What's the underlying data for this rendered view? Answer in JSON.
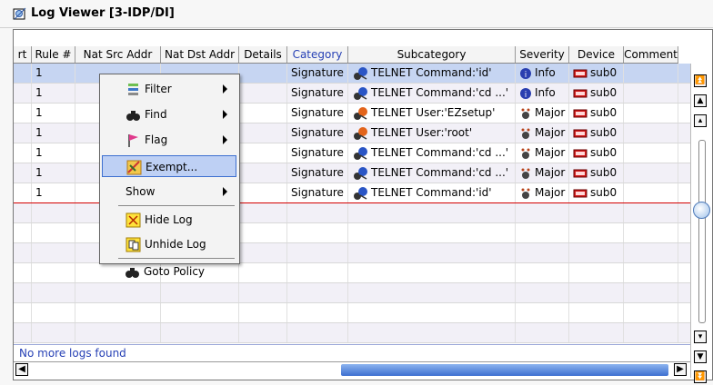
{
  "window": {
    "title": "Log Viewer [3-IDP/DI]"
  },
  "columns": [
    {
      "label": "rt",
      "w": 20
    },
    {
      "label": "Rule #",
      "w": 48
    },
    {
      "label": "Nat Src Addr",
      "w": 94
    },
    {
      "label": "Nat Dst Addr",
      "w": 86
    },
    {
      "label": "Details",
      "w": 53
    },
    {
      "label": "Category",
      "w": 67
    },
    {
      "label": "Subcategory",
      "w": 184
    },
    {
      "label": "Severity",
      "w": 59
    },
    {
      "label": "Device",
      "w": 60
    },
    {
      "label": "Comment",
      "w": 60
    }
  ],
  "rows": [
    {
      "rule": "1",
      "category": "Signature",
      "subcategory": "TELNET Command:'id'",
      "severity": "Info",
      "device": "sub0"
    },
    {
      "rule": "1",
      "category": "Signature",
      "subcategory": "TELNET Command:'cd ...'",
      "severity": "Info",
      "device": "sub0"
    },
    {
      "rule": "1",
      "category": "Signature",
      "subcategory": "TELNET User:'EZsetup'",
      "severity": "Major",
      "device": "sub0"
    },
    {
      "rule": "1",
      "category": "Signature",
      "subcategory": "TELNET User:'root'",
      "severity": "Major",
      "device": "sub0"
    },
    {
      "rule": "1",
      "category": "Signature",
      "subcategory": "TELNET Command:'cd ...'",
      "severity": "Major",
      "device": "sub0"
    },
    {
      "rule": "1",
      "category": "Signature",
      "subcategory": "TELNET Command:'cd ...'",
      "severity": "Major",
      "device": "sub0"
    },
    {
      "rule": "1",
      "category": "Signature",
      "subcategory": "TELNET Command:'id'",
      "severity": "Major",
      "device": "sub0"
    }
  ],
  "status": {
    "text": "No more logs found"
  },
  "context_menu": {
    "filter": "Filter",
    "find": "Find",
    "flag": "Flag",
    "exempt": "Exempt...",
    "show": "Show",
    "hide_log": "Hide Log",
    "unhide_log": "Unhide Log",
    "goto_policy": "Goto Policy"
  },
  "colors": {
    "selected_row": "#c6d5f2",
    "highlight": "#bed0f4",
    "link_blue": "#2741b5",
    "error_red": "#d40000"
  }
}
